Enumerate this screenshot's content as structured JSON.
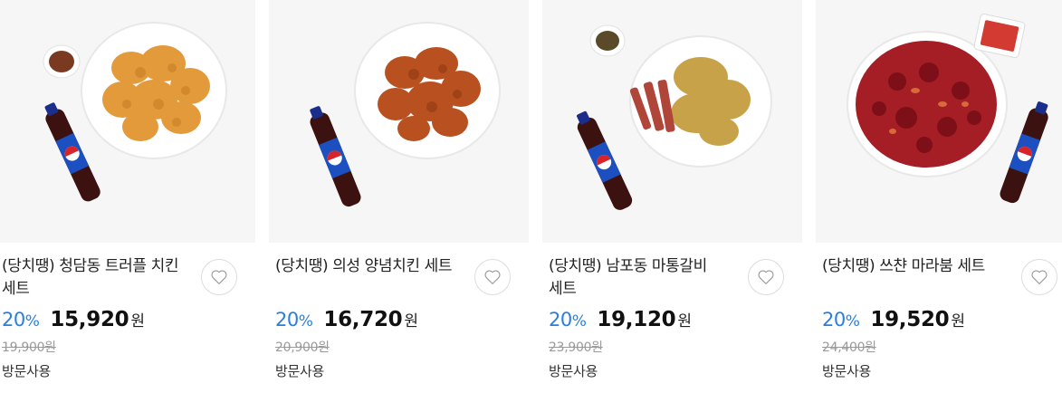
{
  "colors": {
    "discount": "#2a7fde",
    "heart_border": "#dcdcdc",
    "image_bg": "#f6f6f6"
  },
  "products": [
    {
      "title": "(당치땡) 청담동 트러플 치킨 세트",
      "discount_value": "20",
      "discount_unit": "%",
      "price": "15,920",
      "currency": "원",
      "original_price": "19,900원",
      "usage": "방문사용",
      "image_icon": "fried-chicken-pepsi-photo",
      "heart_icon": "heart-outline-icon"
    },
    {
      "title": "(당치땡) 의성 양념치킨 세트",
      "discount_value": "20",
      "discount_unit": "%",
      "price": "16,720",
      "currency": "원",
      "original_price": "20,900원",
      "usage": "방문사용",
      "image_icon": "seasoned-chicken-pepsi-photo",
      "heart_icon": "heart-outline-icon"
    },
    {
      "title": "(당치땡) 남포동 마통갈비 세트",
      "discount_value": "20",
      "discount_unit": "%",
      "price": "19,120",
      "currency": "원",
      "original_price": "23,900원",
      "usage": "방문사용",
      "image_icon": "galbi-chicken-pepsi-photo",
      "heart_icon": "heart-outline-icon"
    },
    {
      "title": "(당치땡) 쓰챤 마라붐 세트",
      "discount_value": "20",
      "discount_unit": "%",
      "price": "19,520",
      "currency": "원",
      "original_price": "24,400원",
      "usage": "방문사용",
      "image_icon": "mala-chicken-pepsi-photo",
      "heart_icon": "heart-outline-icon"
    }
  ]
}
